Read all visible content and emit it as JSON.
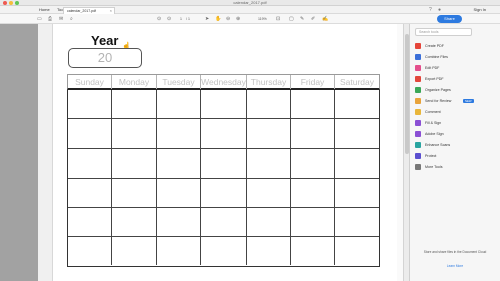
{
  "window": {
    "title": "calendar_2017.pdf"
  },
  "menubar": {
    "home": "Home",
    "tools": "Tools",
    "tab_label": "calendar_2017.pdf",
    "sign_in": "Sign In"
  },
  "toolbar": {
    "page_current": "1",
    "page_total": "/ 1",
    "zoom": "119%",
    "share": "Share"
  },
  "page": {
    "year_label": "Year",
    "year_value": "20",
    "days": [
      "Sunday",
      "Monday",
      "Tuesday",
      "Wednesday",
      "Thursday",
      "Friday",
      "Saturday"
    ]
  },
  "panel": {
    "search_placeholder": "Search tools",
    "tools": [
      {
        "label": "Create PDF",
        "color": "#e5453a"
      },
      {
        "label": "Combine Files",
        "color": "#3b6fd8"
      },
      {
        "label": "Edit PDF",
        "color": "#e44f8c"
      },
      {
        "label": "Export PDF",
        "color": "#e2463b"
      },
      {
        "label": "Organize Pages",
        "color": "#3aa757"
      },
      {
        "label": "Send for Review",
        "color": "#e8a33a",
        "badge": "NEW"
      },
      {
        "label": "Comment",
        "color": "#e9b63a"
      },
      {
        "label": "Fill & Sign",
        "color": "#8a4fd4"
      },
      {
        "label": "Adobe Sign",
        "color": "#8a4fd4"
      },
      {
        "label": "Enhance Scans",
        "color": "#29a4a0"
      },
      {
        "label": "Protect",
        "color": "#5b4fcf"
      },
      {
        "label": "More Tools",
        "color": "#777777"
      }
    ],
    "footer": "Store and share files in the Document Cloud",
    "learn_more": "Learn More"
  }
}
